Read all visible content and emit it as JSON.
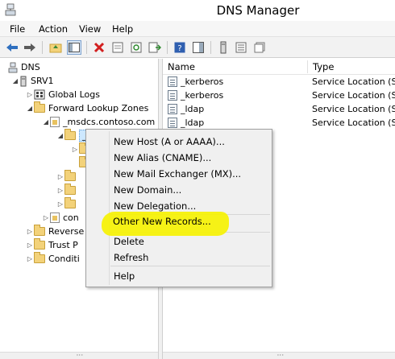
{
  "window": {
    "title": "DNS Manager"
  },
  "menubar": {
    "items": [
      "File",
      "Action",
      "View",
      "Help"
    ]
  },
  "toolbar": {
    "buttons": [
      "back-arrow-icon",
      "forward-arrow-icon",
      "up-folder-icon",
      "show-hide-tree-icon",
      "delete-icon",
      "properties-icon",
      "refresh-icon",
      "export-list-icon",
      "help-icon",
      "action-pane-icon",
      "server-icon",
      "zone-list-icon",
      "record-icon"
    ],
    "accent": "#2f6fbf"
  },
  "tree": {
    "root": "DNS",
    "server": "SRV1",
    "global_logs": "Global Logs",
    "forward_zones": "Forward Lookup Zones",
    "msdcs": "_msdcs.contoso.com",
    "selected_child": "_",
    "partial_con": "con",
    "partial_reverse": "Reverse",
    "partial_trust": "Trust P",
    "partial_cond": "Conditi"
  },
  "list": {
    "columns": [
      "Name",
      "Type"
    ],
    "rows": [
      {
        "name": "_kerberos",
        "type": "Service Location (SR"
      },
      {
        "name": "_kerberos",
        "type": "Service Location (SR"
      },
      {
        "name": "_ldap",
        "type": "Service Location (SR"
      },
      {
        "name": "_ldap",
        "type": "Service Location (SR"
      }
    ]
  },
  "context_menu": {
    "items": [
      "New Host (A or AAAA)...",
      "New Alias (CNAME)...",
      "New Mail Exchanger (MX)...",
      "New Domain...",
      "New Delegation...",
      "Other New Records...",
      "Delete",
      "Refresh",
      "Help"
    ],
    "highlight_color": "#f5f10a"
  },
  "scrollbar": {
    "grip": "'''"
  }
}
